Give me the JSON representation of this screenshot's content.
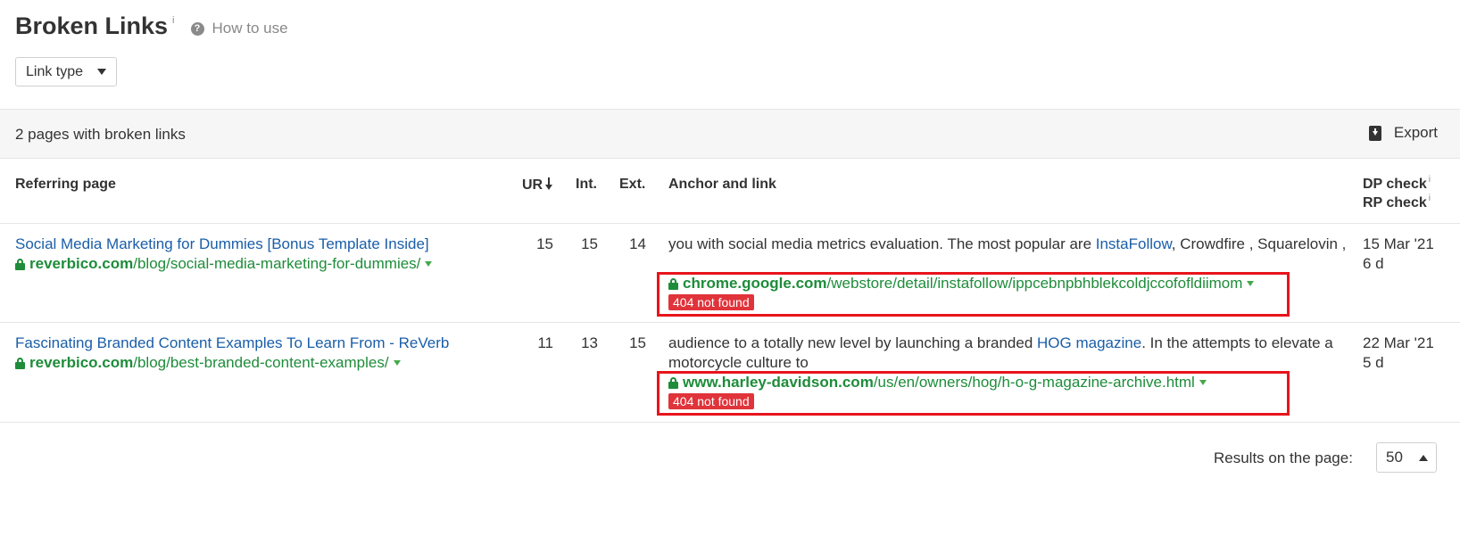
{
  "header": {
    "title": "Broken Links",
    "info_mark": "i",
    "how_to_use": "How to use",
    "help_icon_glyph": "?"
  },
  "filters": {
    "link_type_label": "Link type"
  },
  "summary": {
    "count_text": "2 pages with broken links",
    "export_label": "Export"
  },
  "table": {
    "columns": {
      "referring_page": "Referring page",
      "ur": "UR",
      "int": "Int.",
      "ext": "Ext.",
      "anchor_and_link": "Anchor and link",
      "dp_check": "DP check",
      "rp_check": "RP check",
      "info_mark": "i"
    },
    "rows": [
      {
        "title": "Social Media Marketing for Dummies [Bonus Template Inside]",
        "domain": "reverbico.com",
        "path": "/blog/social-media-marketing-for-dummies/",
        "ur": "15",
        "int": "15",
        "ext": "14",
        "anchor_before": "you with social media metrics evaluation. The most popular are ",
        "anchor_link": "InstaFollow",
        "anchor_after": ", Crowdfire , Squarelovin ,",
        "target_domain": "chrome.google.com",
        "target_path": "/webstore/detail/instafollow/ippcebnpbhblekcoldjccofofldiimom",
        "status": "404 not found",
        "dp_check": "15 Mar '21",
        "rp_check": "6 d"
      },
      {
        "title": "Fascinating Branded Content Examples To Learn From - ReVerb",
        "domain": "reverbico.com",
        "path": "/blog/best-branded-content-examples/",
        "ur": "11",
        "int": "13",
        "ext": "15",
        "anchor_before": "audience to a totally new level by launching a branded ",
        "anchor_link": "HOG magazine",
        "anchor_after": ". In the attempts to elevate a motorcycle culture to",
        "target_domain": "www.harley-davidson.com",
        "target_path": "/us/en/owners/hog/h-o-g-magazine-archive.html",
        "status": "404 not found",
        "dp_check": "22 Mar '21",
        "rp_check": "5 d"
      }
    ]
  },
  "pagination": {
    "results_label": "Results on the page:",
    "per_page_value": "50"
  },
  "colors": {
    "link_blue": "#1a5ea8",
    "url_green": "#1e8c3a",
    "badge_red": "#e0333a",
    "highlight_red": "#e8141c"
  }
}
